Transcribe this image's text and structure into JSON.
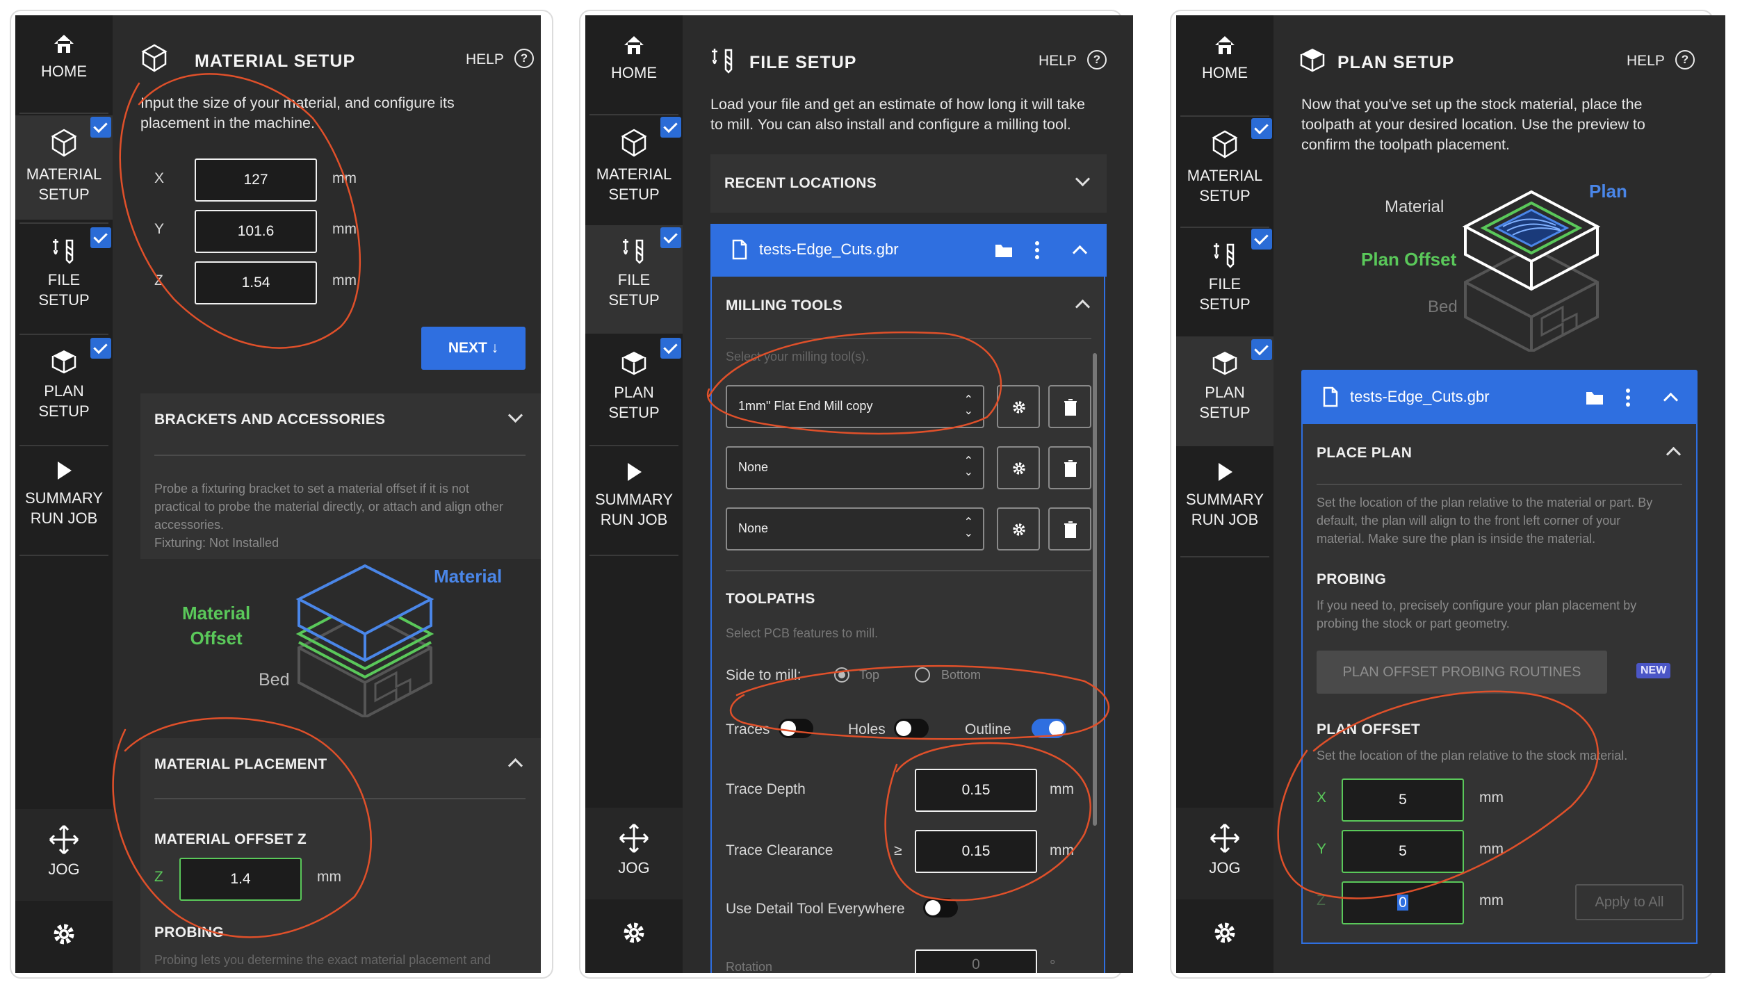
{
  "rail": {
    "home": "HOME",
    "material": [
      "MATERIAL",
      "SETUP"
    ],
    "file": [
      "FILE",
      "SETUP"
    ],
    "plan": [
      "PLAN",
      "SETUP"
    ],
    "summary": [
      "SUMMARY",
      "RUN JOB"
    ],
    "jog": "JOG"
  },
  "help_label": "HELP",
  "material_setup": {
    "title": "MATERIAL SETUP",
    "intro": [
      "Input the size of your material, and configure its",
      "placement in the machine."
    ],
    "dims": [
      {
        "axis": "X",
        "value": "127",
        "unit": "mm"
      },
      {
        "axis": "Y",
        "value": "101.6",
        "unit": "mm"
      },
      {
        "axis": "Z",
        "value": "1.54",
        "unit": "mm"
      }
    ],
    "next_label": "NEXT",
    "brackets_title": "BRACKETS AND ACCESSORIES",
    "brackets_desc": [
      "Probe a fixturing bracket to set a material offset if it is not",
      "practical to probe the material directly, or attach and align other",
      "accessories."
    ],
    "fixturing": "Fixturing: Not Installed",
    "diagram": {
      "material": "Material",
      "offset": [
        "Material",
        "Offset"
      ],
      "bed": "Bed"
    },
    "placement_title": "MATERIAL PLACEMENT",
    "offset_z_title": "MATERIAL OFFSET Z",
    "offset_z": {
      "axis": "Z",
      "value": "1.4",
      "unit": "mm"
    },
    "probing_title": "PROBING",
    "probing_cut": "Probing lets you determine the exact material placement and"
  },
  "file_setup": {
    "title": "FILE SETUP",
    "intro": [
      "Load your file and get an estimate of how long it will take",
      "to mill. You can also install and configure a milling tool."
    ],
    "recent": "RECENT LOCATIONS",
    "file_name": "tests-Edge_Cuts.gbr",
    "tools_title": "MILLING TOOLS",
    "tools_hint": "Select your milling tool(s).",
    "tools": [
      "1mm\" Flat End Mill copy",
      "None",
      "None"
    ],
    "toolpaths_title": "TOOLPATHS",
    "toolpaths_hint": "Select PCB features to mill.",
    "side_label": "Side to mill:",
    "side_top": "Top",
    "side_bottom": "Bottom",
    "traces": "Traces",
    "holes": "Holes",
    "outline": "Outline",
    "trace_depth_label": "Trace Depth",
    "trace_depth": "0.15",
    "trace_clear_label": "Trace Clearance",
    "trace_clear_sym": "≥",
    "trace_clear": "0.15",
    "unit": "mm",
    "detail_tool": "Use Detail Tool Everywhere",
    "rotation_cut": "Rotation",
    "rotation_val": "0",
    "rotation_unit": "°"
  },
  "plan_setup": {
    "title": "PLAN SETUP",
    "intro": [
      "Now that you've set up the stock material, place the",
      "toolpath at your desired location. Use the preview to",
      "confirm the toolpath placement."
    ],
    "diagram": {
      "plan": "Plan",
      "material": "Material",
      "offset": "Plan Offset",
      "bed": "Bed"
    },
    "file_name": "tests-Edge_Cuts.gbr",
    "place_title": "PLACE PLAN",
    "place_desc": [
      "Set the location of the plan relative to the material or part. By",
      "default, the plan will align to the front left corner of your",
      "material. Make sure the plan is inside the material."
    ],
    "probing_title": "PROBING",
    "probing_desc": [
      "If you need to, precisely configure your plan placement by",
      "probing the stock or part geometry."
    ],
    "probing_btn": "PLAN OFFSET PROBING ROUTINES",
    "new_badge": "NEW",
    "offset_title": "PLAN OFFSET",
    "offset_desc": "Set the location of the plan relative to the stock material.",
    "offsets": [
      {
        "axis": "X",
        "value": "5",
        "unit": "mm"
      },
      {
        "axis": "Y",
        "value": "5",
        "unit": "mm"
      },
      {
        "axis": "Z",
        "value": "0",
        "unit": "mm"
      }
    ],
    "apply_all": "Apply to All"
  },
  "colors": {
    "accent": "#2f6fe0",
    "green": "#5ac85a",
    "annotation": "#e0502a",
    "panel": "#2b2b2b",
    "rail": "#1f1f1f"
  }
}
